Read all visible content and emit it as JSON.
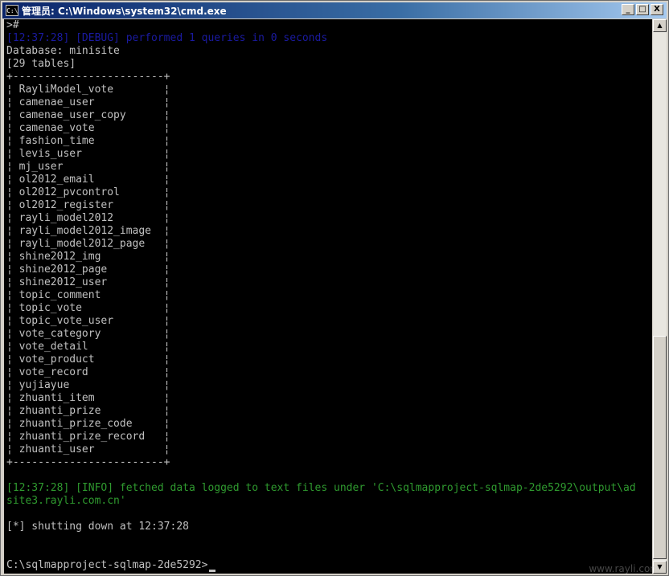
{
  "window": {
    "title": "管理员: C:\\Windows\\system32\\cmd.exe",
    "icon": "cmd-icon",
    "buttons": {
      "minimize": "_",
      "maximize": "□",
      "close": "X"
    }
  },
  "console": {
    "prompt_line": ">#",
    "debug_line": "[12:37:28] [DEBUG] performed 1 queries in 0 seconds",
    "database_line": "Database: minisite",
    "tables_count_line": "[29 tables]",
    "border_line": "+------------------------+",
    "tables": [
      "RayliModel_vote",
      "camenae_user",
      "camenae_user_copy",
      "camenae_vote",
      "fashion_time",
      "levis_user",
      "mj_user",
      "ol2012_email",
      "ol2012_pvcontrol",
      "ol2012_register",
      "rayli_model2012",
      "rayli_model2012_image",
      "rayli_model2012_page",
      "shine2012_img",
      "shine2012_page",
      "shine2012_user",
      "topic_comment",
      "topic_vote",
      "topic_vote_user",
      "vote_category",
      "vote_detail",
      "vote_product",
      "vote_record",
      "yujiayue",
      "zhuanti_item",
      "zhuanti_prize",
      "zhuanti_prize_code",
      "zhuanti_prize_record",
      "zhuanti_user"
    ],
    "info_line_1": "[12:37:28] [INFO] fetched data logged to text files under 'C:\\sqlmapproject-sqlmap-2de5292\\output\\ad",
    "info_line_2": "site3.rayli.com.cn'",
    "shutdown_line": "[*] shutting down at 12:37:28",
    "final_prompt": "C:\\sqlmapproject-sqlmap-2de5292>"
  },
  "colors": {
    "console_background": "#000000",
    "console_text": "#c0c0c0",
    "debug_text": "#1a1aa0",
    "info_text": "#2f9a2f",
    "titlebar_start": "#0a246a",
    "titlebar_end": "#a6caf0"
  },
  "scrollbar": {
    "up_icon": "scroll-up-arrow-icon",
    "down_icon": "scroll-down-arrow-icon"
  },
  "watermark": "www.rayli.com"
}
